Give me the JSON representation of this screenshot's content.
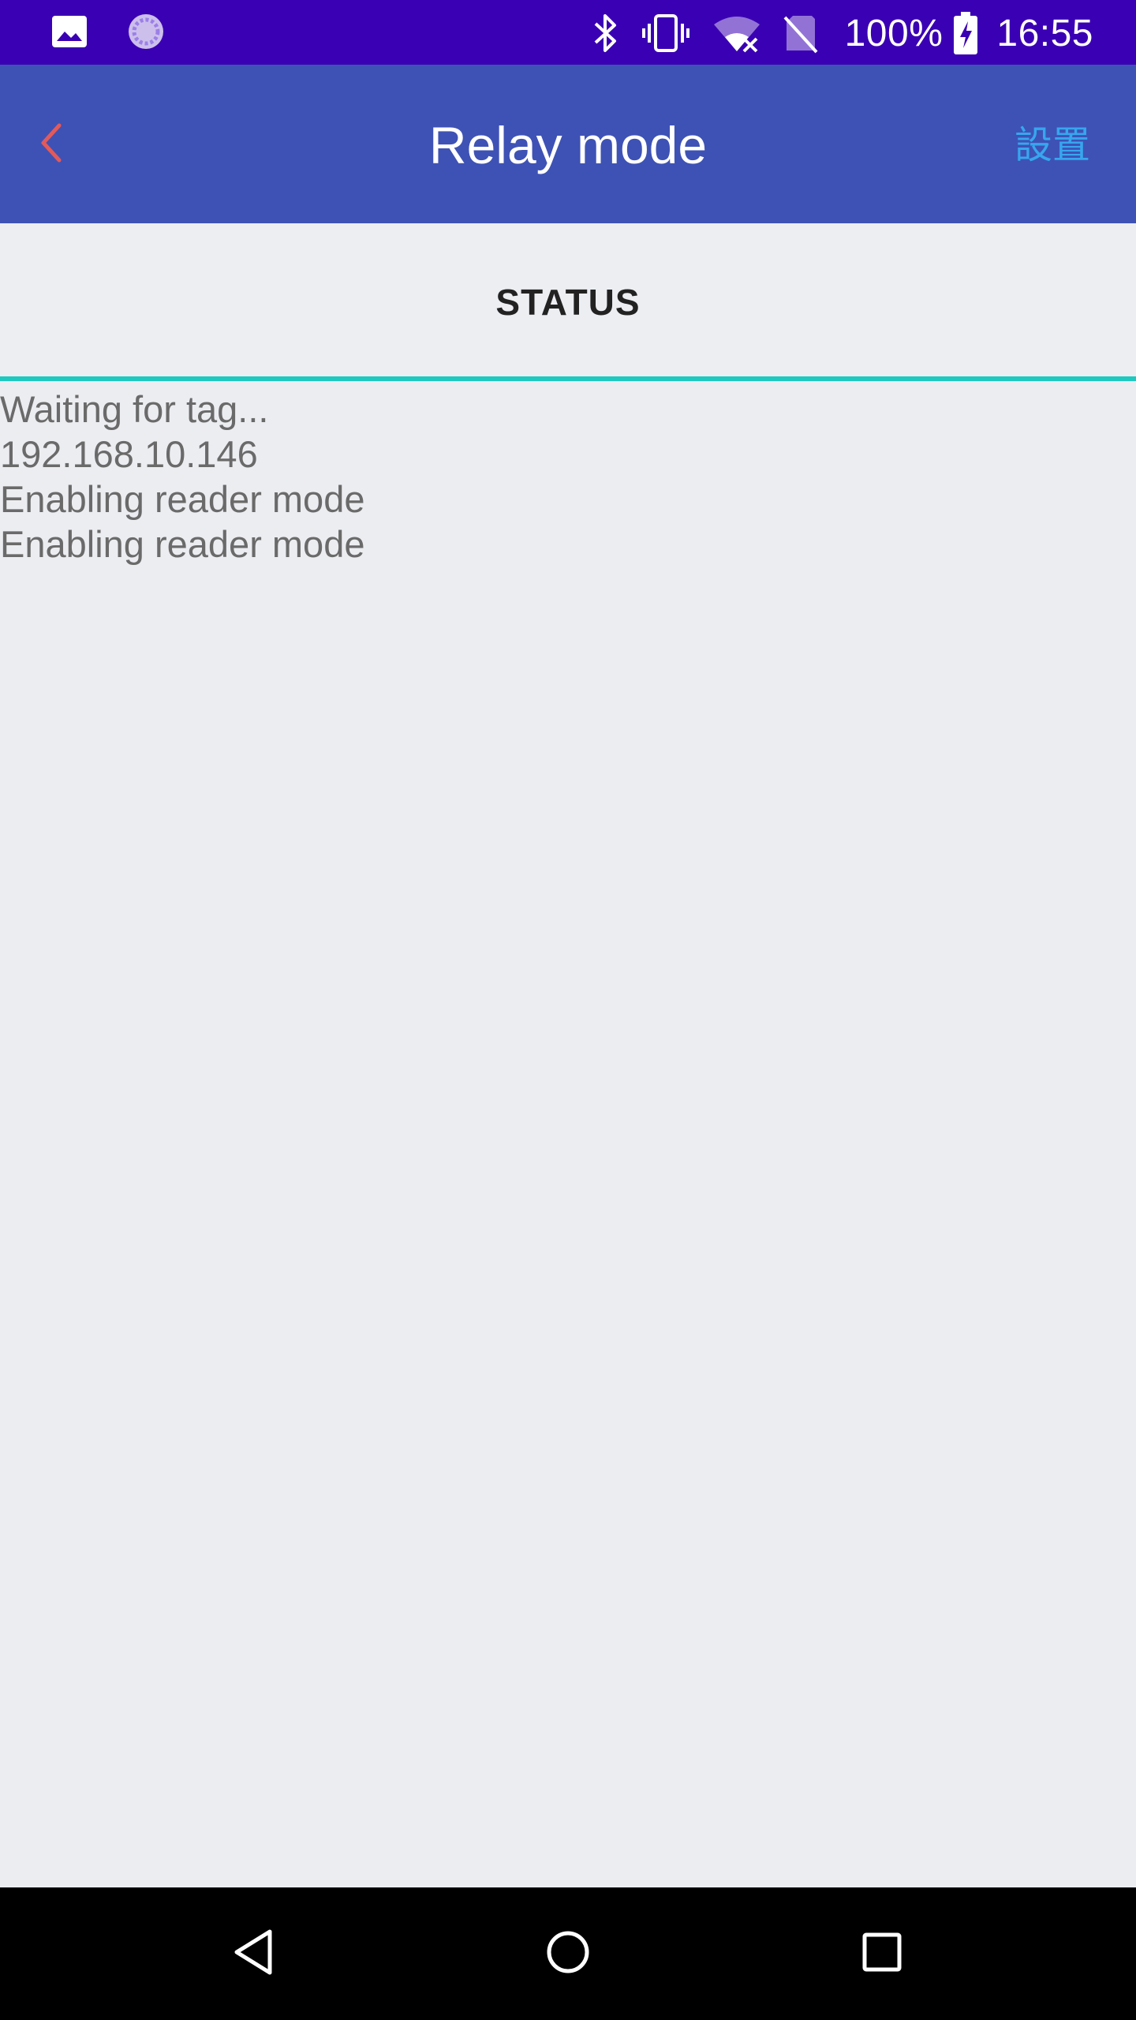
{
  "status_bar": {
    "battery_percent": "100%",
    "time": "16:55",
    "icons": [
      "image-icon",
      "sync-icon",
      "bluetooth-icon",
      "vibrate-icon",
      "wifi-off-icon",
      "no-sim-icon",
      "battery-charging-icon"
    ],
    "background_color": "#3a00b3"
  },
  "app_bar": {
    "title": "Relay mode",
    "settings_label": "設置",
    "back_icon": "chevron-left-icon",
    "background_color": "#3e52b5",
    "back_color": "#e35a5a",
    "settings_color": "#37a6ee"
  },
  "tabs": [
    {
      "label": "STATUS",
      "selected": true
    }
  ],
  "log_lines": [
    "Waiting for tag...",
    "192.168.10.146",
    "Enabling reader mode",
    "Enabling reader mode"
  ],
  "nav_bar": {
    "buttons": [
      "back-triangle-icon",
      "home-circle-icon",
      "recents-square-icon"
    ]
  },
  "colors": {
    "tab_indicator": "#1ec9c0",
    "content_background": "#ecedf1"
  }
}
